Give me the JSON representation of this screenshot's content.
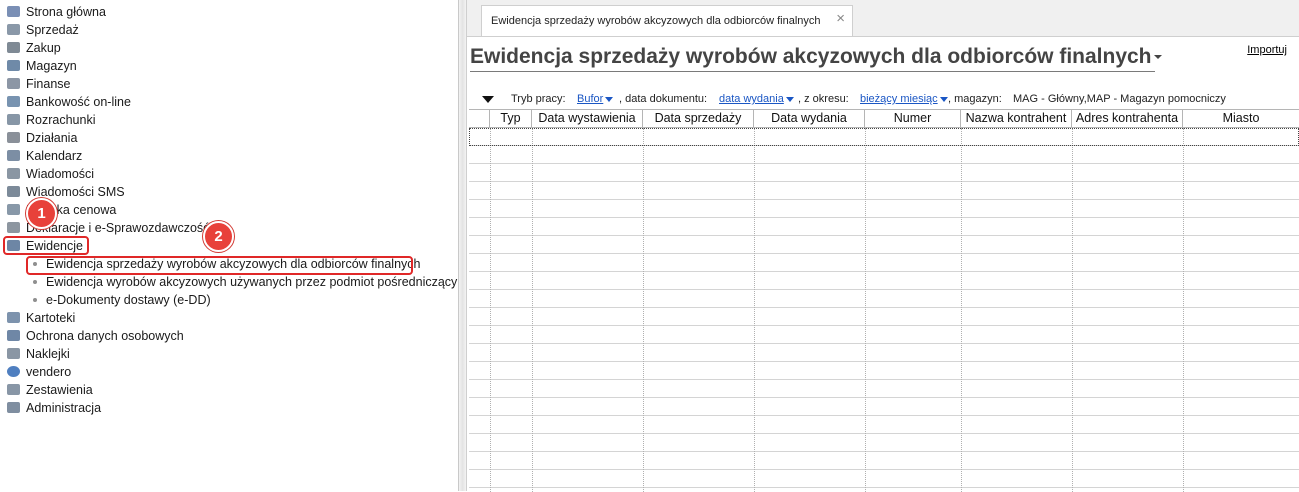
{
  "sidebar": {
    "items": [
      {
        "label": "Strona główna",
        "icon": "home-icon",
        "color": "#7a8fb5"
      },
      {
        "label": "Sprzedaż",
        "icon": "sales-icon",
        "color": "#8a98a8"
      },
      {
        "label": "Zakup",
        "icon": "purchase-icon",
        "color": "#7f8a95"
      },
      {
        "label": "Magazyn",
        "icon": "warehouse-icon",
        "color": "#6f8aa8"
      },
      {
        "label": "Finanse",
        "icon": "finance-icon",
        "color": "#8c96a5"
      },
      {
        "label": "Bankowość on-line",
        "icon": "bank-icon",
        "color": "#7893b0"
      },
      {
        "label": "Rozrachunki",
        "icon": "settlements-icon",
        "color": "#8796a6"
      },
      {
        "label": "Działania",
        "icon": "activities-icon",
        "color": "#8a9099"
      },
      {
        "label": "Kalendarz",
        "icon": "calendar-icon",
        "color": "#7c8ea4"
      },
      {
        "label": "Wiadomości",
        "icon": "messages-icon",
        "color": "#8a96a3"
      },
      {
        "label": "Wiadomości SMS",
        "icon": "sms-icon",
        "color": "#7c8a99"
      },
      {
        "label": "Polityka cenowa",
        "icon": "pricing-icon",
        "color": "#8898a8"
      },
      {
        "label": "Deklaracje i e-Sprawozdawczość",
        "icon": "declarations-icon",
        "color": "#8d96a0"
      },
      {
        "label": "Ewidencje",
        "icon": "records-icon",
        "color": "#6d86a5"
      }
    ],
    "subitems": [
      {
        "label": "Ewidencja sprzedaży wyrobów akcyzowych dla odbiorców finalnych"
      },
      {
        "label": "Ewidencja wyrobów akcyzowych używanych przez podmiot pośredniczący"
      },
      {
        "label": "e-Dokumenty dostawy (e-DD)"
      }
    ],
    "items_after": [
      {
        "label": "Kartoteki",
        "icon": "files-icon",
        "color": "#7d93ad"
      },
      {
        "label": "Ochrona danych osobowych",
        "icon": "data-protection-icon",
        "color": "#6f87a6"
      },
      {
        "label": "Naklejki",
        "icon": "labels-icon",
        "color": "#8a96a4"
      },
      {
        "label": "vendero",
        "icon": "vendero-icon",
        "color": "#4f7fc0"
      },
      {
        "label": "Zestawienia",
        "icon": "reports-icon",
        "color": "#8896a6"
      },
      {
        "label": "Administracja",
        "icon": "admin-icon",
        "color": "#7f8ea0"
      }
    ],
    "badges": [
      "1",
      "2"
    ]
  },
  "tab": {
    "label": "Ewidencja sprzedaży wyrobów akcyzowych dla odbiorców finalnych",
    "close": "×"
  },
  "page": {
    "title": "Ewidencja sprzedaży wyrobów akcyzowych dla odbiorców finalnych",
    "import_label": "Importuj"
  },
  "filters": {
    "mode_label": "Tryb pracy:",
    "mode_value": "Bufor",
    "doc_date_label": ", data dokumentu:",
    "doc_date_value": "data wydania",
    "period_label": ", z okresu:",
    "period_value": "bieżący miesiąc",
    "warehouse_label": ", magazyn:",
    "warehouse_value": "MAG - Główny,MAP - Magazyn pomocniczy"
  },
  "grid": {
    "columns": [
      "Typ",
      "Data wystawienia",
      "Data sprzedaży",
      "Data wydania",
      "Numer",
      "Nazwa kontrahent",
      "Adres kontrahenta",
      "Miasto"
    ]
  },
  "colors": {
    "highlight": "#e02828",
    "badge": "#e8413a",
    "link": "#1a56c4"
  }
}
